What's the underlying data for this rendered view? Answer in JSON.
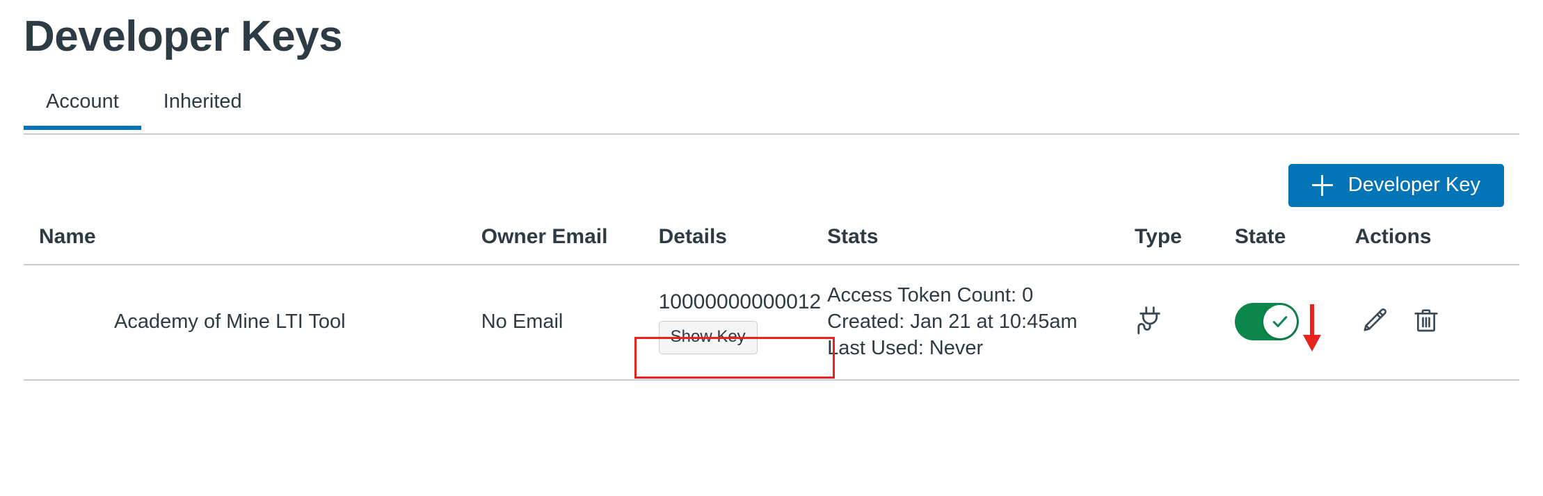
{
  "page": {
    "title": "Developer Keys"
  },
  "tabs": [
    {
      "label": "Account",
      "active": true
    },
    {
      "label": "Inherited",
      "active": false
    }
  ],
  "toolbar": {
    "add_key_label": "Developer Key",
    "add_key_icon": "plus-icon",
    "accent_color": "#0374B5"
  },
  "table": {
    "headers": {
      "name": "Name",
      "owner_email": "Owner Email",
      "details": "Details",
      "stats": "Stats",
      "type": "Type",
      "state": "State",
      "actions": "Actions"
    },
    "rows": [
      {
        "name": "Academy of Mine LTI Tool",
        "owner_email": "No Email",
        "details": {
          "key_id": "10000000000012",
          "show_key_label": "Show Key"
        },
        "stats": {
          "access_token_count": "Access Token Count: 0",
          "created": "Created: Jan 21 at 10:45am",
          "last_used": "Last Used: Never"
        },
        "type_icon": "plug-icon",
        "state": {
          "enabled": true,
          "color": "#0B874B",
          "icon": "check-icon"
        },
        "actions": {
          "edit_icon": "pencil-icon",
          "delete_icon": "trash-icon"
        }
      }
    ]
  },
  "annotations": {
    "color": "#E8221C",
    "key_id_highlight": "10000000000012",
    "state_arrow_target": "State"
  }
}
